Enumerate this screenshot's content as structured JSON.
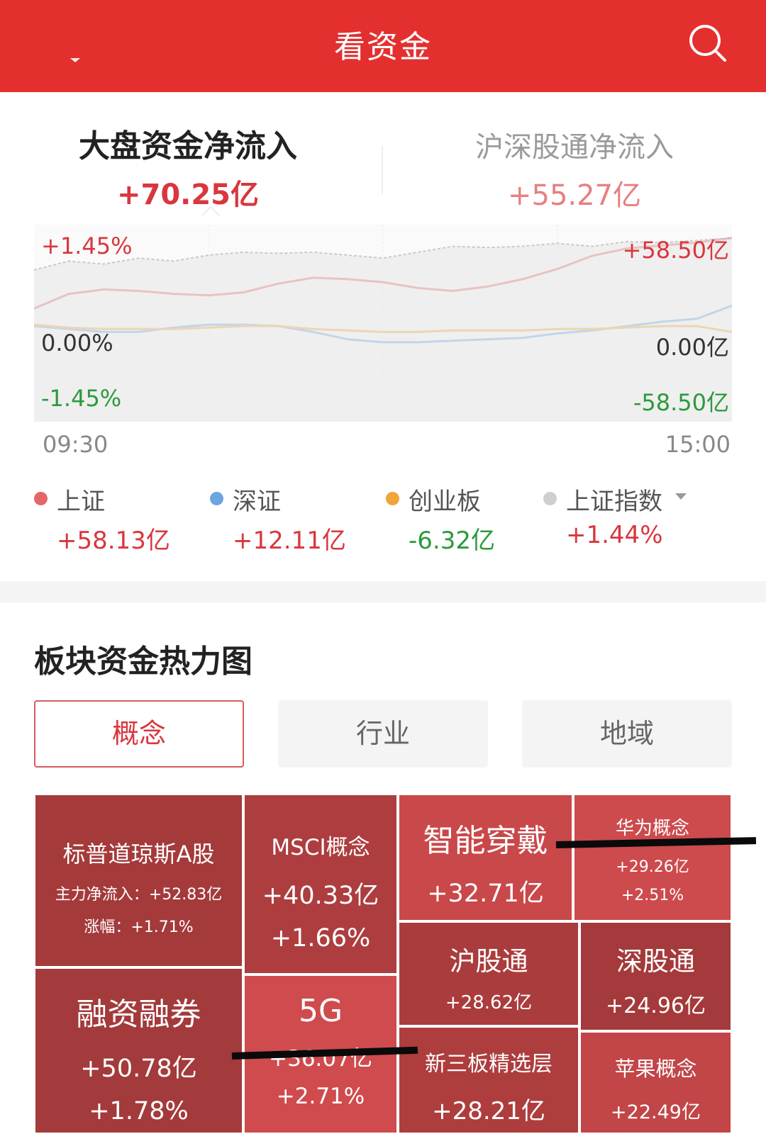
{
  "header": {
    "title": "看资金"
  },
  "flow_tabs": [
    {
      "title": "大盘资金净流入",
      "value": "+70.25亿"
    },
    {
      "title": "沪深股通净流入",
      "value": "+55.27亿"
    }
  ],
  "chart": {
    "left_axis": {
      "top": "+1.45%",
      "mid": "0.00%",
      "bottom": "-1.45%"
    },
    "right_axis": {
      "top": "+58.50亿",
      "mid": "0.00亿",
      "bottom": "-58.50亿"
    },
    "time_start": "09:30",
    "time_end": "15:00"
  },
  "chart_data": {
    "type": "line",
    "x_start": "09:30",
    "x_end": "15:00",
    "ylim": [
      -58.5,
      58.5
    ],
    "series": [
      {
        "name": "上证",
        "color": "#e46668",
        "values": [
          10,
          20,
          23,
          22,
          20,
          19,
          21,
          27,
          31,
          30,
          28,
          24,
          22,
          25,
          30,
          37,
          46,
          51,
          53,
          55,
          58
        ]
      },
      {
        "name": "深证",
        "color": "#6aa6df",
        "values": [
          -2,
          -4,
          -6,
          -6,
          -3,
          -1,
          -1,
          -2,
          -6,
          -11,
          -13,
          -13,
          -12,
          -11,
          -10,
          -7,
          -5,
          -2,
          1,
          3,
          12
        ]
      },
      {
        "name": "创业板",
        "color": "#f1a43a",
        "values": [
          -1,
          -3,
          -4,
          -4,
          -4,
          -3,
          -2,
          -2,
          -4,
          -5,
          -6,
          -6,
          -5,
          -5,
          -5,
          -4,
          -4,
          -3,
          -2,
          -2,
          -6
        ]
      },
      {
        "name": "上证指数",
        "color": "#c9c9c9",
        "values": [
          0.9,
          1.05,
          1.0,
          1.1,
          1.05,
          1.15,
          1.2,
          1.18,
          1.2,
          1.15,
          1.1,
          1.2,
          1.3,
          1.28,
          1.3,
          1.35,
          1.3,
          1.38,
          1.36,
          1.4,
          1.44
        ],
        "unit": "%"
      }
    ]
  },
  "legend": [
    {
      "label": "上证",
      "value": "+58.13亿",
      "dot_color": "#e46668",
      "value_color": "#d9363e"
    },
    {
      "label": "深证",
      "value": "+12.11亿",
      "dot_color": "#6aa6df",
      "value_color": "#d9363e"
    },
    {
      "label": "创业板",
      "value": "-6.32亿",
      "dot_color": "#f1a43a",
      "value_color": "#2b9a3c"
    },
    {
      "label": "上证指数",
      "value": "+1.44%",
      "dot_color": "#cfcfcf",
      "value_color": "#d9363e"
    }
  ],
  "heatmap": {
    "title": "板块资金热力图",
    "tabs": [
      "概念",
      "行业",
      "地域"
    ],
    "tiles": [
      {
        "name": "标普道琼斯A股",
        "flow": "主力净流入：+52.83亿",
        "change": "涨幅：+1.71%",
        "color": "#a53a3b"
      },
      {
        "name": "MSCI概念",
        "flow": "+40.33亿",
        "change": "+1.66%",
        "color": "#ad3d3f"
      },
      {
        "name": "智能穿戴",
        "flow": "+32.71亿",
        "change": "",
        "color": "#c9484a"
      },
      {
        "name": "华为概念",
        "flow": "+29.26亿",
        "change": "+2.51%",
        "color": "#cd4a4d"
      },
      {
        "name": "沪股通",
        "flow": "+28.62亿",
        "change": "",
        "color": "#ab3c3d"
      },
      {
        "name": "深股通",
        "flow": "+24.96亿",
        "change": "",
        "color": "#a43a3b"
      },
      {
        "name": "融资融券",
        "flow": "+50.78亿",
        "change": "+1.78%",
        "color": "#a33a3b"
      },
      {
        "name": "5G",
        "flow": "+36.07亿",
        "change": "+2.71%",
        "color": "#cf4b4d"
      },
      {
        "name": "新三板精选层",
        "flow": "+28.21亿",
        "change": "",
        "color": "#ae3d3e"
      },
      {
        "name": "苹果概念",
        "flow": "+22.49亿",
        "change": "",
        "color": "#c24547"
      }
    ]
  }
}
